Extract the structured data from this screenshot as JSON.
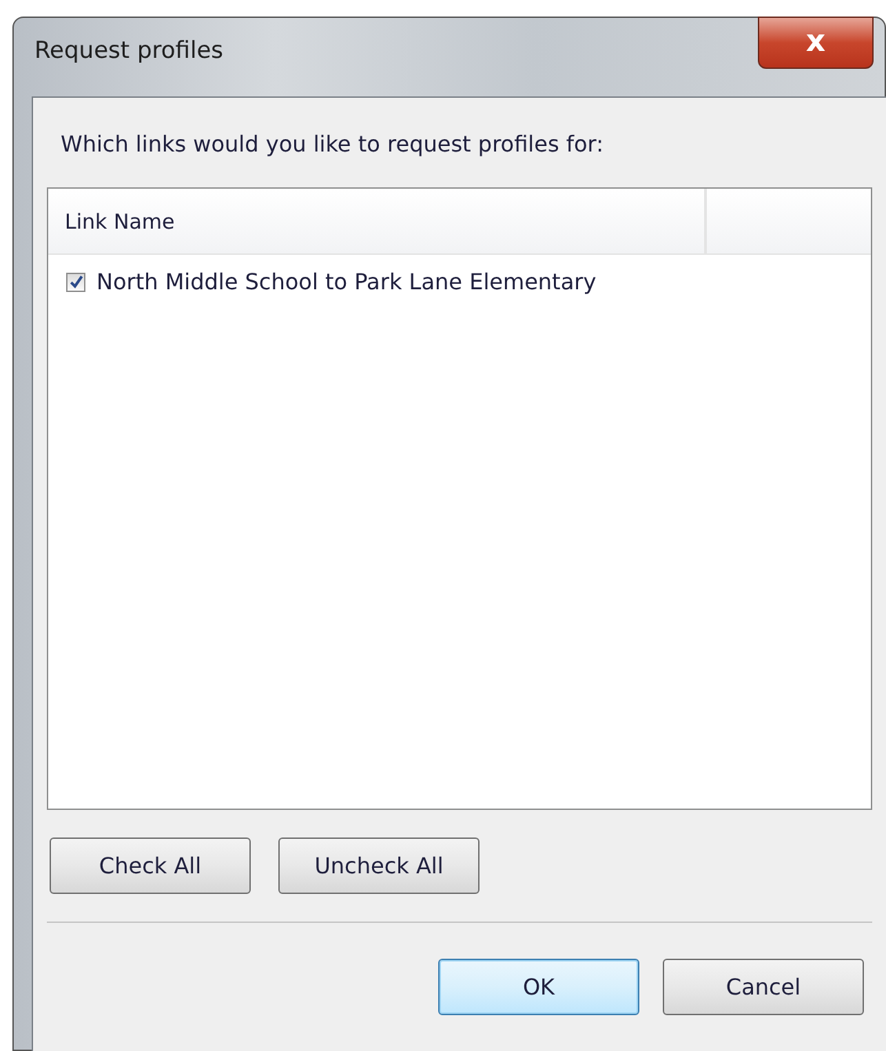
{
  "window": {
    "title": "Request profiles",
    "close": "x"
  },
  "prompt": "Which links would you like to request profiles for:",
  "table": {
    "columns": [
      "Link Name"
    ],
    "rows": [
      {
        "name": "North Middle School to Park Lane Elementary",
        "checked": true
      }
    ]
  },
  "list_buttons": [
    "Check All",
    "Uncheck All"
  ],
  "dialog_buttons": [
    {
      "label": "OK",
      "default": true
    },
    {
      "label": "Cancel",
      "default": false
    }
  ]
}
